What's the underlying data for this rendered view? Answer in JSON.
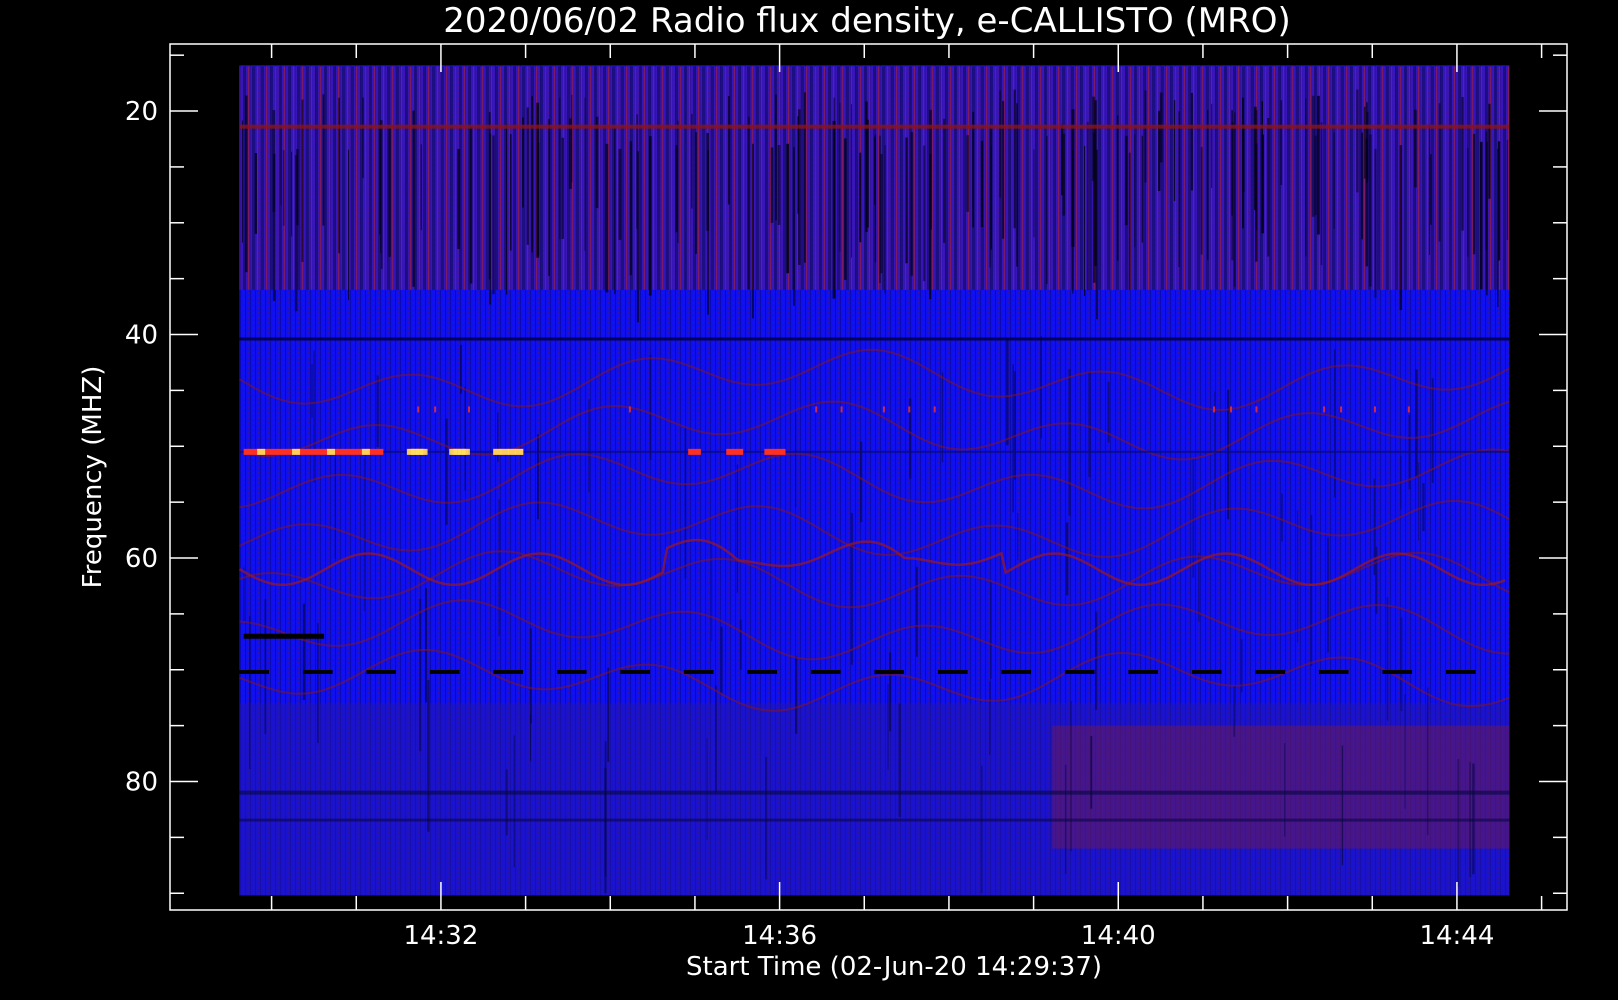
{
  "chart_data": {
    "type": "heatmap",
    "title": "2020/06/02  Radio flux density, e-CALLISTO (MRO)",
    "xlabel": "Start Time (02-Jun-20 14:29:37)",
    "ylabel": "Frequency (MHZ)",
    "x_ticks": [
      "14:32",
      "14:36",
      "14:40",
      "14:44"
    ],
    "x_tick_minutes": [
      2.38,
      6.38,
      10.38,
      14.38
    ],
    "x_range_minutes": [
      -0.82,
      15.68
    ],
    "y_ticks": [
      20,
      40,
      60,
      80
    ],
    "y_range": [
      91.5,
      14
    ],
    "y_inverted": true,
    "data_extent": {
      "x_minutes": [
        0,
        15.0
      ],
      "y_mhz": [
        15.9,
        90.2
      ]
    },
    "colors": {
      "background": "#000000",
      "base": "#1010ee",
      "red": "#8a1414",
      "hot": "#ff3020",
      "peak": "#ffe060"
    },
    "features": {
      "hot_band_mhz": 50.5,
      "hot_band_segments_minutes": [
        [
          0.05,
          1.7
        ],
        [
          2.0,
          2.2
        ],
        [
          2.5,
          2.7
        ],
        [
          3.0,
          3.35
        ],
        [
          5.3,
          5.45
        ],
        [
          5.75,
          5.95
        ],
        [
          6.2,
          6.45
        ]
      ],
      "dotted_band_mhz": 46.7,
      "dotted_dark_band_mhz": 70.2,
      "dark_line_mhz": 67.0,
      "dark_line_minutes": [
        0.05,
        1.0
      ],
      "dark_band_mhz": 40.4,
      "red_band_mhz": 21.4
    }
  }
}
